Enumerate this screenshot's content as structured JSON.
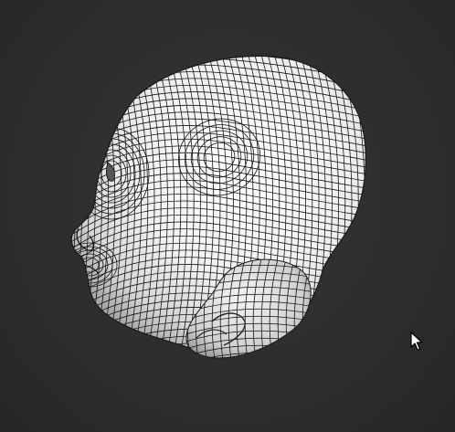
{
  "viewport": {
    "background_color": "#2f2f2f",
    "model": {
      "name": "head-mesh",
      "kind": "polygon-wireframe-on-shaded-surface",
      "surface_color": "#f2f2f2",
      "wire_color": "#141414",
      "shadow_color": "#9a9a9a"
    }
  },
  "cursor": {
    "icon": "mouse-pointer-icon",
    "color": "#ffffff",
    "outline": "#000000"
  }
}
